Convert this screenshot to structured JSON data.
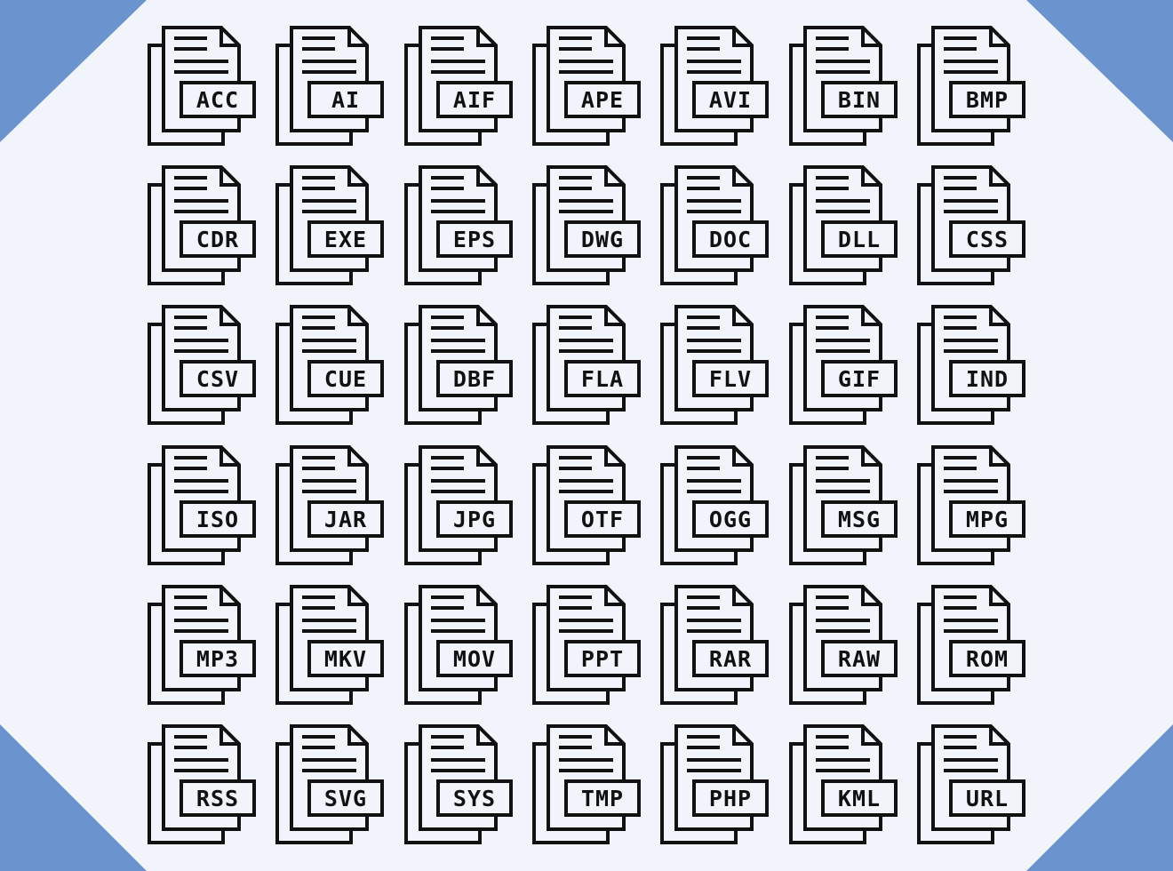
{
  "colors": {
    "background": "#f1f5fb",
    "corner_accent": "#6b94cf",
    "stroke": "#111111"
  },
  "icon_type": "stacked-document-file-icon",
  "rows": [
    [
      "ACC",
      "AI",
      "AIF",
      "APE",
      "AVI",
      "BIN",
      "BMP"
    ],
    [
      "CDR",
      "EXE",
      "EPS",
      "DWG",
      "DOC",
      "DLL",
      "CSS"
    ],
    [
      "CSV",
      "CUE",
      "DBF",
      "FLA",
      "FLV",
      "GIF",
      "IND"
    ],
    [
      "ISO",
      "JAR",
      "JPG",
      "OTF",
      "OGG",
      "MSG",
      "MPG"
    ],
    [
      "MP3",
      "MKV",
      "MOV",
      "PPT",
      "RAR",
      "RAW",
      "ROM"
    ],
    [
      "RSS",
      "SVG",
      "SYS",
      "TMP",
      "PHP",
      "KML",
      "URL"
    ]
  ]
}
